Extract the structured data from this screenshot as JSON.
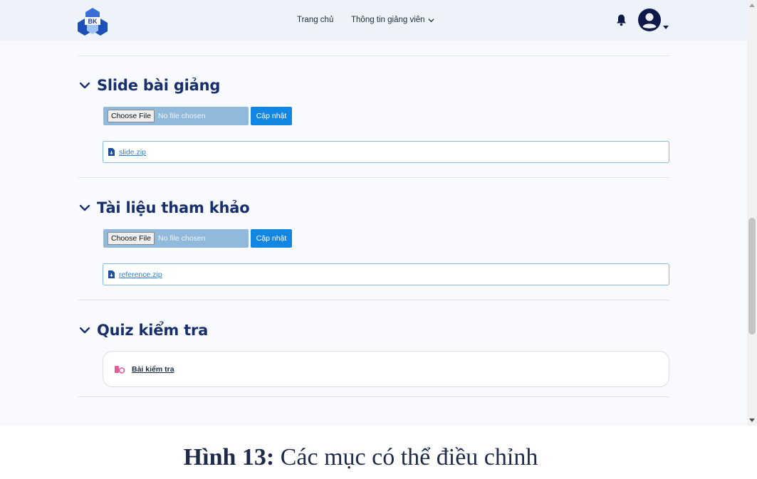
{
  "header": {
    "logo_text": "BK",
    "nav_home": "Trang chủ",
    "nav_teacher_info": "Thông tin giảng viên",
    "icons": {
      "notifications": "bell-icon",
      "account": "user-circle-icon",
      "dropdown": "chevron-down-icon"
    }
  },
  "sections": [
    {
      "title": "Slide bài giảng",
      "choose_file_label": "Choose File",
      "no_file_text": "No file chosen",
      "update_label": "Cập nhật",
      "attachment": "slide.zip"
    },
    {
      "title": "Tài liệu tham khảo",
      "choose_file_label": "Choose File",
      "no_file_text": "No file chosen",
      "update_label": "Cập nhật",
      "attachment": "reference.zip"
    },
    {
      "title": "Quiz kiểm tra",
      "quiz_link": "Bài kiểm tra"
    }
  ],
  "caption": {
    "label": "Hình 13:",
    "text": "Các mục có thể điều chỉnh"
  },
  "colors": {
    "header_bg": "#eef3fb",
    "title": "#17306d",
    "primary_button": "#1187e3",
    "file_input_bg": "#90b9dc",
    "link": "#2f7bd0",
    "quiz_icon": "#e05f9a"
  }
}
